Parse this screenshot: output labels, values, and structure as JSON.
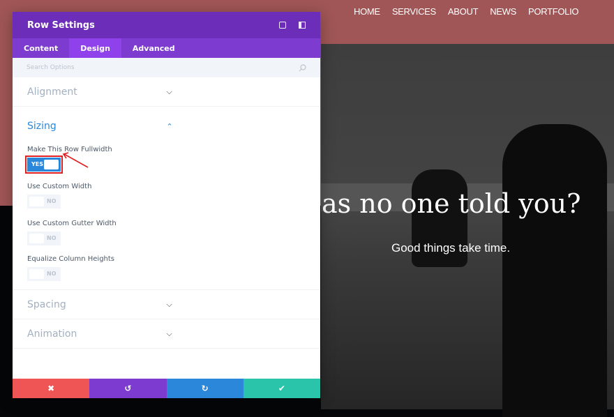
{
  "website": {
    "nav": [
      "HOME",
      "SERVICES",
      "ABOUT",
      "NEWS",
      "PORTFOLIO"
    ],
    "hero_title": "as no one told you?",
    "hero_subtitle": "Good things take time."
  },
  "panel": {
    "title": "Row Settings",
    "tabs": [
      {
        "label": "Content"
      },
      {
        "label": "Design",
        "active": true
      },
      {
        "label": "Advanced"
      }
    ],
    "search_placeholder": "Search Options",
    "sections": {
      "alignment": "Alignment",
      "sizing": "Sizing",
      "spacing": "Spacing",
      "animation": "Animation"
    },
    "options": [
      {
        "label": "Make This Row Fullwidth",
        "value": "YES"
      },
      {
        "label": "Use Custom Width",
        "value": "NO"
      },
      {
        "label": "Use Custom Gutter Width",
        "value": "NO"
      },
      {
        "label": "Equalize Column Heights",
        "value": "NO"
      }
    ],
    "footer": {
      "cancel": "✖",
      "undo": "↺",
      "redo": "↻",
      "save": "✔"
    },
    "colors": {
      "header": "#6c2eb9",
      "tabs": "#7e3bd0",
      "accent": "#2b87da",
      "cancel": "#ef5555",
      "undo": "#7e3bd0",
      "redo": "#2b87da",
      "save": "#29c4a9",
      "highlight": "#e02020"
    }
  }
}
